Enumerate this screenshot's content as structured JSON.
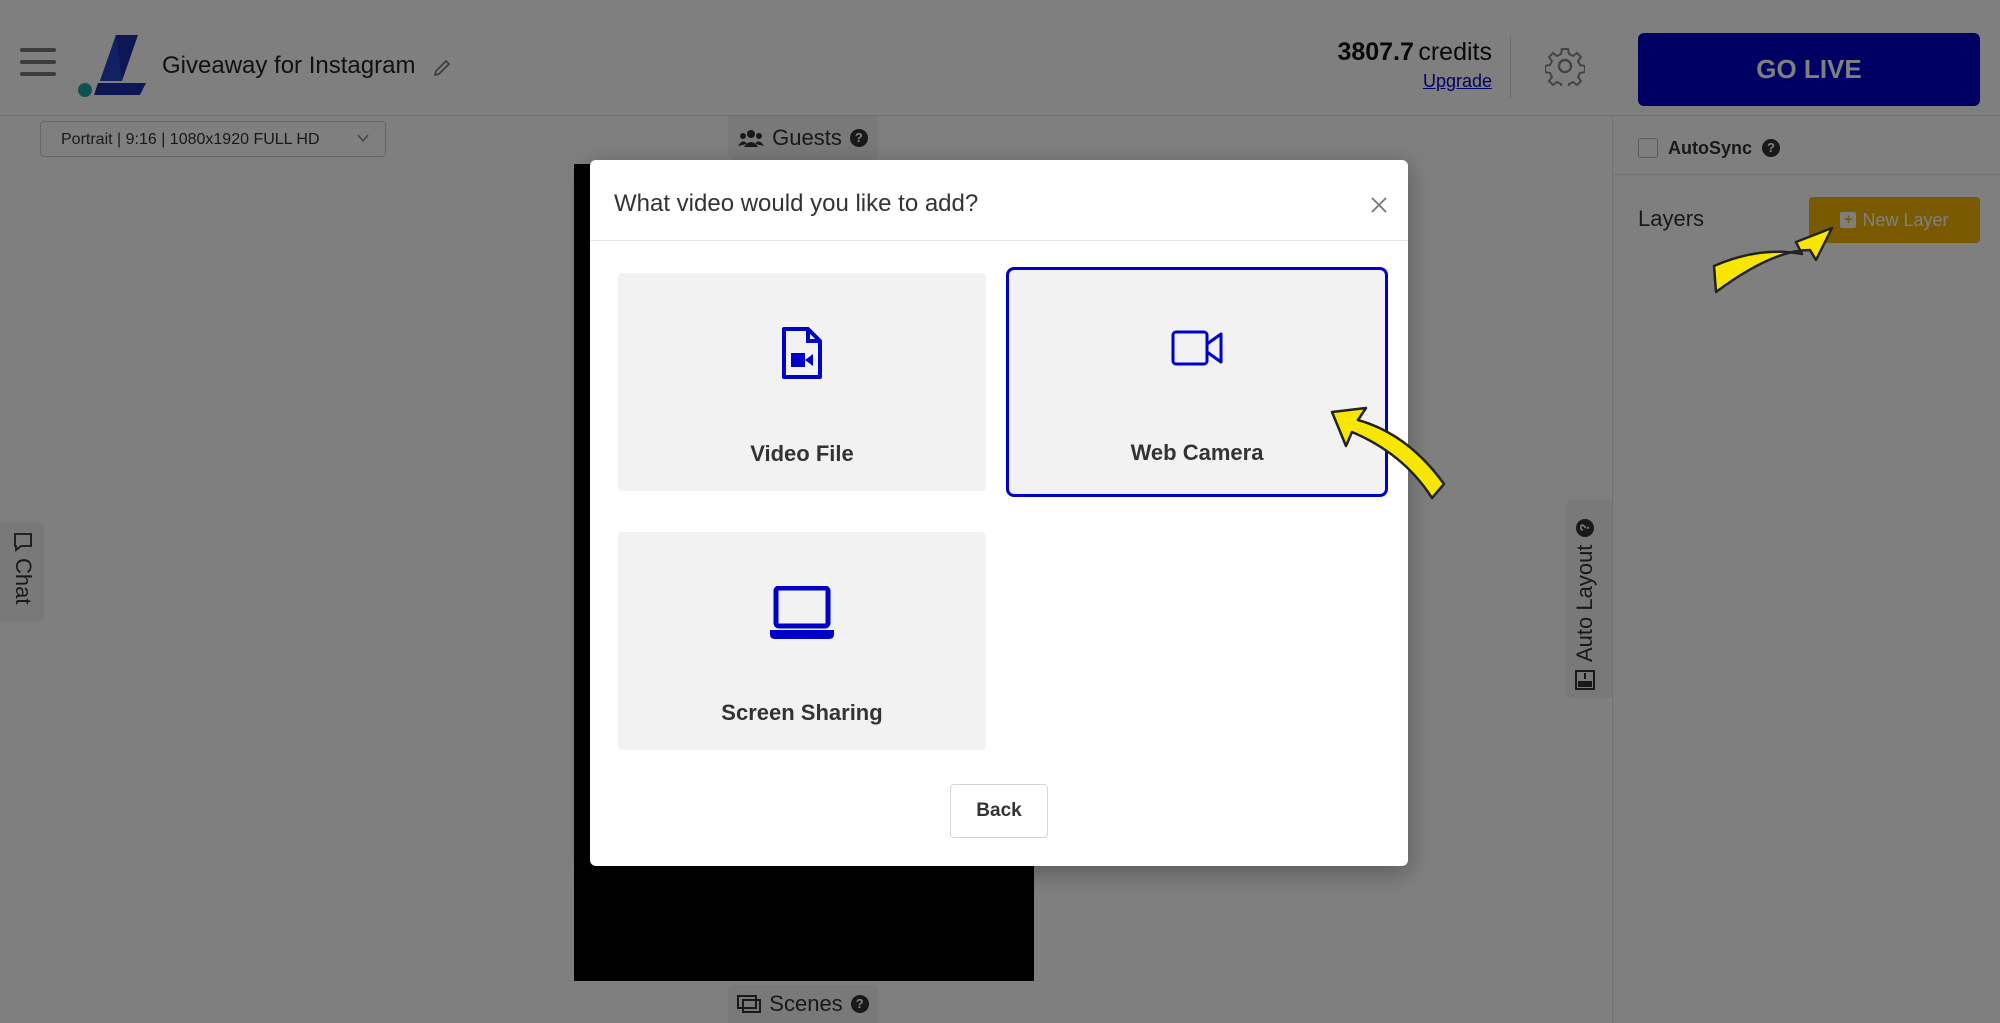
{
  "header": {
    "project_title": "Giveaway for Instagram",
    "credits_value": "3807.7",
    "credits_label": "credits",
    "upgrade_label": "Upgrade",
    "go_live_label": "GO LIVE"
  },
  "canvas": {
    "format_value": "Portrait | 9:16 | 1080x1920 FULL HD",
    "guests_label": "Guests",
    "scenes_label": "Scenes",
    "chat_label": "Chat",
    "auto_layout_label": "Auto Layout",
    "help_mark": "?"
  },
  "right_panel": {
    "autosync_label": "AutoSync",
    "layers_label": "Layers",
    "new_layer_label": "New Layer"
  },
  "modal": {
    "title": "What video would you like to add?",
    "options": [
      {
        "label": "Video File",
        "icon": "video-file-icon"
      },
      {
        "label": "Web Camera",
        "icon": "video-camera-icon",
        "selected": true
      },
      {
        "label": "Screen Sharing",
        "icon": "laptop-icon"
      }
    ],
    "back_label": "Back"
  },
  "colors": {
    "primary": "#0000c8",
    "accent": "#f5b400",
    "arrow": "#f7e600"
  }
}
